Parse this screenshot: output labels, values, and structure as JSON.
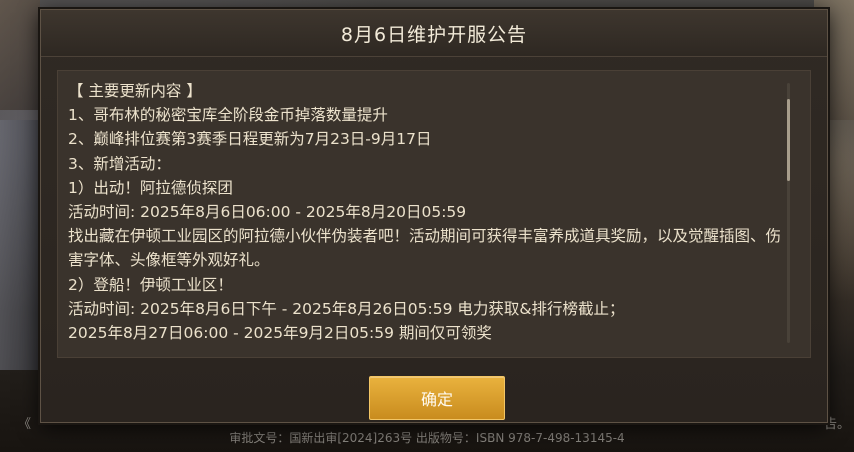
{
  "dialog": {
    "title": "8月6日维护开服公告",
    "lines": [
      "【 主要更新内容 】",
      "1、哥布林的秘密宝库全阶段金币掉落数量提升",
      "2、巅峰排位赛第3赛季日程更新为7月23日-9月17日",
      "3、新增活动：",
      "1）出动！阿拉德侦探团",
      "活动时间: 2025年8月6日06:00 - 2025年8月20日05:59",
      "找出藏在伊顿工业园区的阿拉德小伙伴伪装者吧！活动期间可获得丰富养成道具奖励，以及觉醒插图、伤害字体、头像框等外观好礼。",
      "2）登船！伊顿工业区！",
      "活动时间: 2025年8月6日下午 - 2025年8月26日05:59 电力获取&排行榜截止；",
      "2025年8月27日06:00 - 2025年9月2日05:59 期间仅可领奖"
    ],
    "confirm_label": "确定",
    "scroll_position": 0
  },
  "background": {
    "footer_text": "审批文号：国新出审[2024]263号 出版物号：ISBN 978-7-498-13145-4",
    "left_fragment": "《",
    "right_fragment": "告。"
  }
}
